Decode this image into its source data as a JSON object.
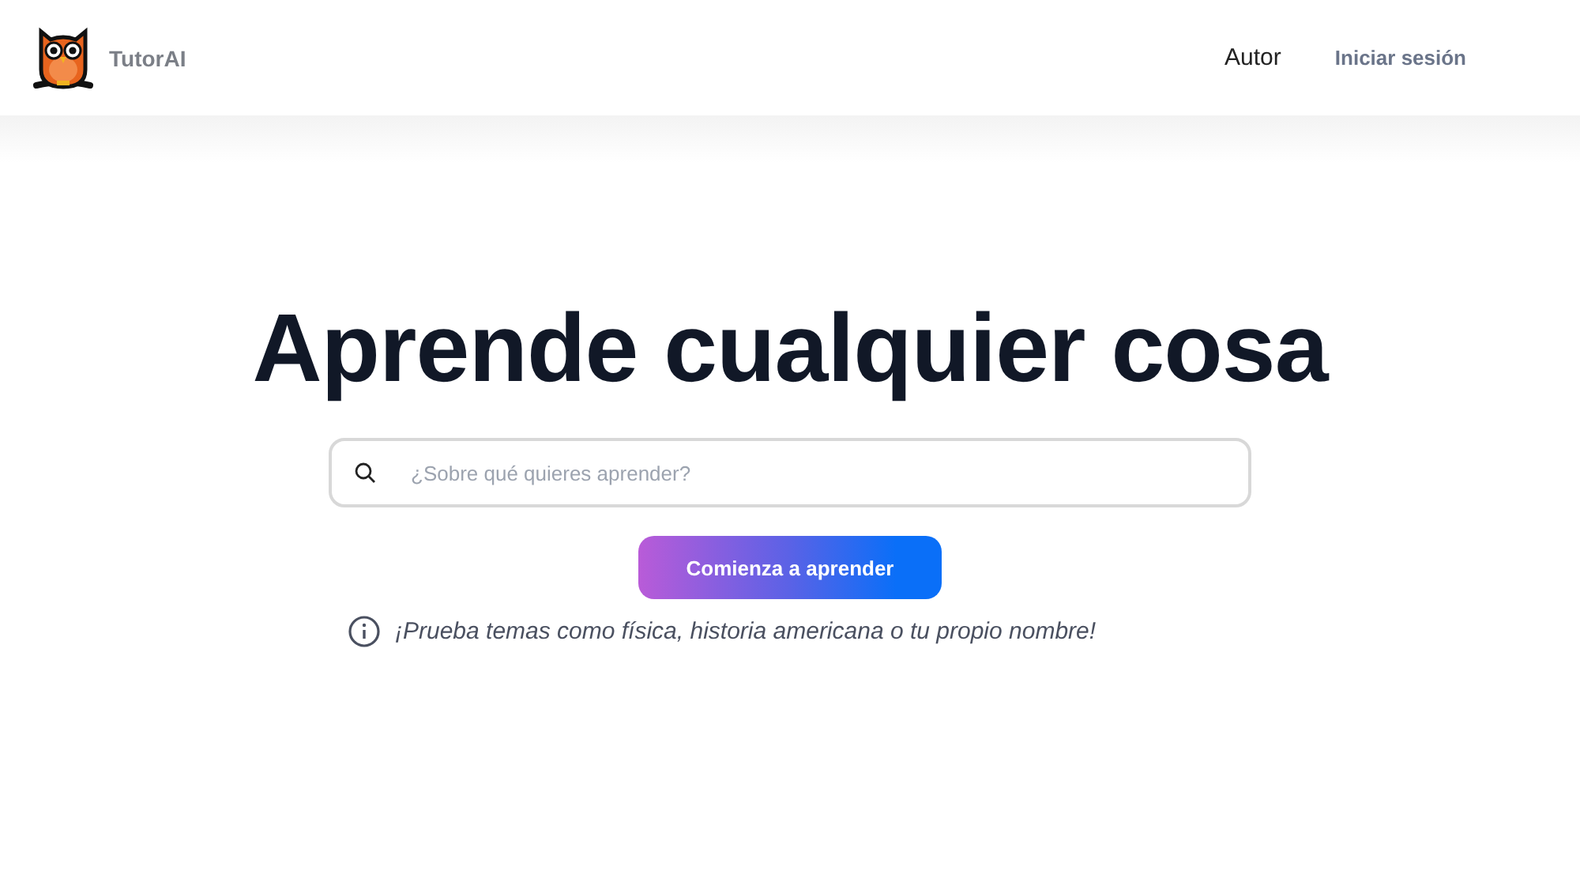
{
  "header": {
    "brand": "TutorAI",
    "nav": [
      {
        "label": "Autor",
        "kind": "plain"
      },
      {
        "label": "Iniciar sesión",
        "kind": "login"
      }
    ]
  },
  "hero": {
    "title": "Aprende cualquier cosa",
    "search": {
      "placeholder": "¿Sobre qué quieres aprender?"
    },
    "button": "Comienza a aprender",
    "hint": "¡Prueba temas como física, historia americana o tu propio nombre!"
  }
}
